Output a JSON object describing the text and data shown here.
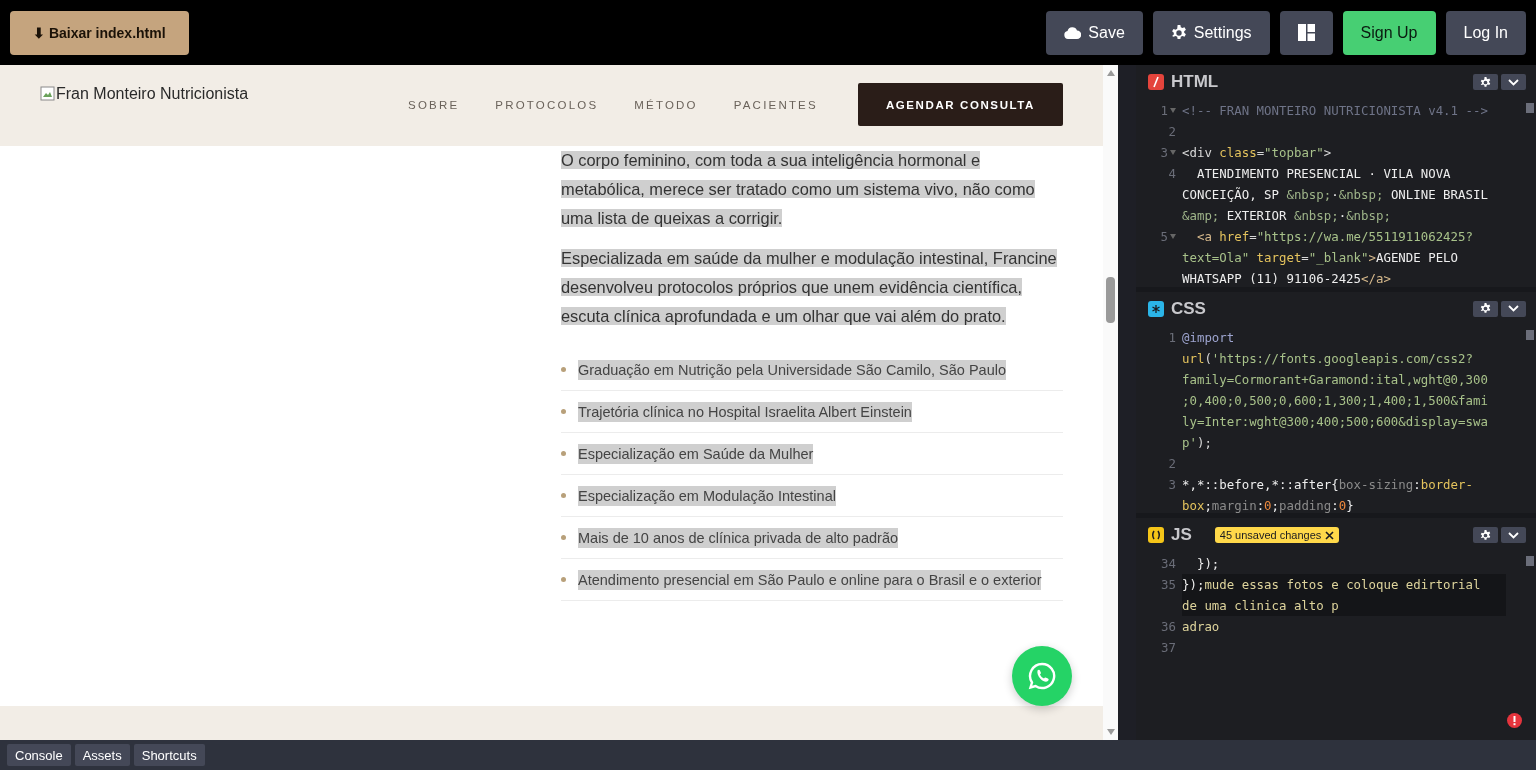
{
  "topbar": {
    "download_button": "⬇ Baixar index.html",
    "buttons": [
      {
        "kind": "save",
        "label": "Save"
      },
      {
        "kind": "settings",
        "label": "Settings"
      },
      {
        "kind": "layout"
      },
      {
        "kind": "signup",
        "label": "Sign Up"
      },
      {
        "kind": "login",
        "label": "Log In"
      }
    ]
  },
  "preview": {
    "logo_alt": "Fran Monteiro Nutricionista",
    "nav": [
      "SOBRE",
      "PROTOCOLOS",
      "MÉTODO",
      "PACIENTES"
    ],
    "cta": "AGENDAR CONSULTA",
    "paragraphs": [
      {
        "text": "O corpo feminino, com toda a sua inteligência hormonal e metabólica, merece ser tratado como um sistema vivo, não como uma lista de queixas a corrigir.",
        "selected": true
      },
      {
        "text": "Especializada em saúde da mulher e modulação intestinal, Francine desenvolveu protocolos próprios que unem evidência científica, escuta clínica aprofundada e um olhar que vai além do prato.",
        "selected": true
      }
    ],
    "credentials": [
      {
        "text": "Graduação em Nutrição pela Universidade São Camilo, São Paulo",
        "selected": true
      },
      {
        "text": "Trajetória clínica no Hospital Israelita Albert Einstein",
        "selected": true
      },
      {
        "text": "Especialização em Saúde da Mulher",
        "selected": true
      },
      {
        "text": "Especialização em Modulação Intestinal",
        "selected": true
      },
      {
        "text": "Mais de 10 anos de clínica privada de alto padrão",
        "selected": true
      },
      {
        "text": "Atendimento presencial em São Paulo e online para o Brasil e o exterior",
        "selected": true
      }
    ]
  },
  "editors": [
    {
      "kind": "html",
      "title": "HTML",
      "lines": [
        {
          "number": "1",
          "fold": true,
          "tokens": [
            {
              "kind": "comment",
              "text": "<!-- FRAN MONTEIRO NUTRICIONISTA v4.1 -->"
            }
          ]
        },
        {
          "number": "2",
          "fold": false
        },
        {
          "number": "3",
          "fold": true,
          "tokens": [
            {
              "kind": "punct",
              "text": "<div "
            },
            {
              "kind": "attr",
              "text": "class"
            },
            {
              "kind": "punct",
              "text": "="
            },
            {
              "kind": "string",
              "text": "\"topbar\""
            },
            {
              "kind": "punct",
              "text": ">"
            }
          ]
        },
        {
          "number": "4",
          "fold": false,
          "tokens": [
            {
              "kind": "text",
              "text": "  ATENDIMENTO PRESENCIAL · VILA NOVA"
            }
          ]
        },
        {
          "tokens": [
            {
              "kind": "text",
              "text": "CONCEIÇÃO, SP "
            },
            {
              "kind": "entity",
              "text": "&nbsp;"
            },
            {
              "kind": "text",
              "text": "·"
            },
            {
              "kind": "entity",
              "text": "&nbsp;"
            },
            {
              "kind": "text",
              "text": " ONLINE BRASIL"
            }
          ]
        },
        {
          "tokens": [
            {
              "kind": "entity",
              "text": "&amp;"
            },
            {
              "kind": "text",
              "text": " EXTERIOR "
            },
            {
              "kind": "entity",
              "text": "&nbsp;"
            },
            {
              "kind": "text",
              "text": "·"
            },
            {
              "kind": "entity",
              "text": "&nbsp;"
            }
          ]
        },
        {
          "number": "5",
          "fold": true,
          "tokens": [
            {
              "kind": "tag",
              "text": "  <a "
            },
            {
              "kind": "attr",
              "text": "href"
            },
            {
              "kind": "punct",
              "text": "="
            },
            {
              "kind": "string",
              "text": "\"https://wa.me/5511911062425?"
            }
          ]
        },
        {
          "tokens": [
            {
              "kind": "string",
              "text": "text=Ola\""
            },
            {
              "kind": "attr",
              "text": " target"
            },
            {
              "kind": "punct",
              "text": "="
            },
            {
              "kind": "string",
              "text": "\"_blank\""
            },
            {
              "kind": "tag",
              "text": ">"
            },
            {
              "kind": "text",
              "text": "AGENDE PELO"
            }
          ]
        },
        {
          "tokens": [
            {
              "kind": "text",
              "text": "WHATSAPP (11) 91106-2425"
            },
            {
              "kind": "tag",
              "text": "</a>"
            }
          ]
        }
      ]
    },
    {
      "kind": "css",
      "title": "CSS",
      "lines": [
        {
          "number": "1",
          "fold": false,
          "tokens": [
            {
              "kind": "atrule",
              "text": "@import"
            }
          ]
        },
        {
          "tokens": [
            {
              "kind": "fn",
              "text": "url"
            },
            {
              "kind": "punct",
              "text": "("
            },
            {
              "kind": "string",
              "text": "'https://fonts.googleapis.com/css2?"
            }
          ]
        },
        {
          "tokens": [
            {
              "kind": "string",
              "text": "family=Cormorant+Garamond:ital,wght@0,300"
            }
          ]
        },
        {
          "tokens": [
            {
              "kind": "string",
              "text": ";0,400;0,500;0,600;1,300;1,400;1,500&fami"
            }
          ]
        },
        {
          "tokens": [
            {
              "kind": "string",
              "text": "ly=Inter:wght@300;400;500;600&display=swa"
            }
          ]
        },
        {
          "tokens": [
            {
              "kind": "string",
              "text": "p'"
            },
            {
              "kind": "punct",
              "text": ");"
            }
          ]
        },
        {
          "number": "2",
          "fold": false
        },
        {
          "number": "3",
          "fold": false,
          "tokens": [
            {
              "kind": "text",
              "text": "*,*::before,*::after{"
            },
            {
              "kind": "prop",
              "text": "box-sizing"
            },
            {
              "kind": "text",
              "text": ":"
            },
            {
              "kind": "value",
              "text": "border-"
            }
          ]
        },
        {
          "tokens": [
            {
              "kind": "value",
              "text": "box"
            },
            {
              "kind": "text",
              "text": ";"
            },
            {
              "kind": "prop",
              "text": "margin"
            },
            {
              "kind": "text",
              "text": ":"
            },
            {
              "kind": "number",
              "text": "0"
            },
            {
              "kind": "text",
              "text": ";"
            },
            {
              "kind": "prop",
              "text": "padding"
            },
            {
              "kind": "text",
              "text": ":"
            },
            {
              "kind": "number",
              "text": "0"
            },
            {
              "kind": "text",
              "text": "}"
            }
          ]
        }
      ]
    },
    {
      "kind": "js",
      "title": "JS",
      "badge": "45 unsaved changes",
      "lines": [
        {
          "number": "34",
          "fold": false,
          "tokens": [
            {
              "kind": "text",
              "text": "  });"
            }
          ]
        },
        {
          "number": "35",
          "fold": false,
          "active": true,
          "tokens": [
            {
              "kind": "text",
              "text": "});"
            },
            {
              "kind": "ident",
              "text": "mude essas fotos e coloque edirtorial"
            }
          ]
        },
        {
          "active": true,
          "tokens": [
            {
              "kind": "ident",
              "text": "de uma clinica alto p"
            }
          ]
        },
        {
          "number": "36",
          "fold": false,
          "tokens": [
            {
              "kind": "ident",
              "text": "adrao"
            }
          ]
        },
        {
          "number": "37",
          "fold": false
        }
      ]
    }
  ],
  "bottom_bar": [
    "Console",
    "Assets",
    "Shortcuts"
  ]
}
